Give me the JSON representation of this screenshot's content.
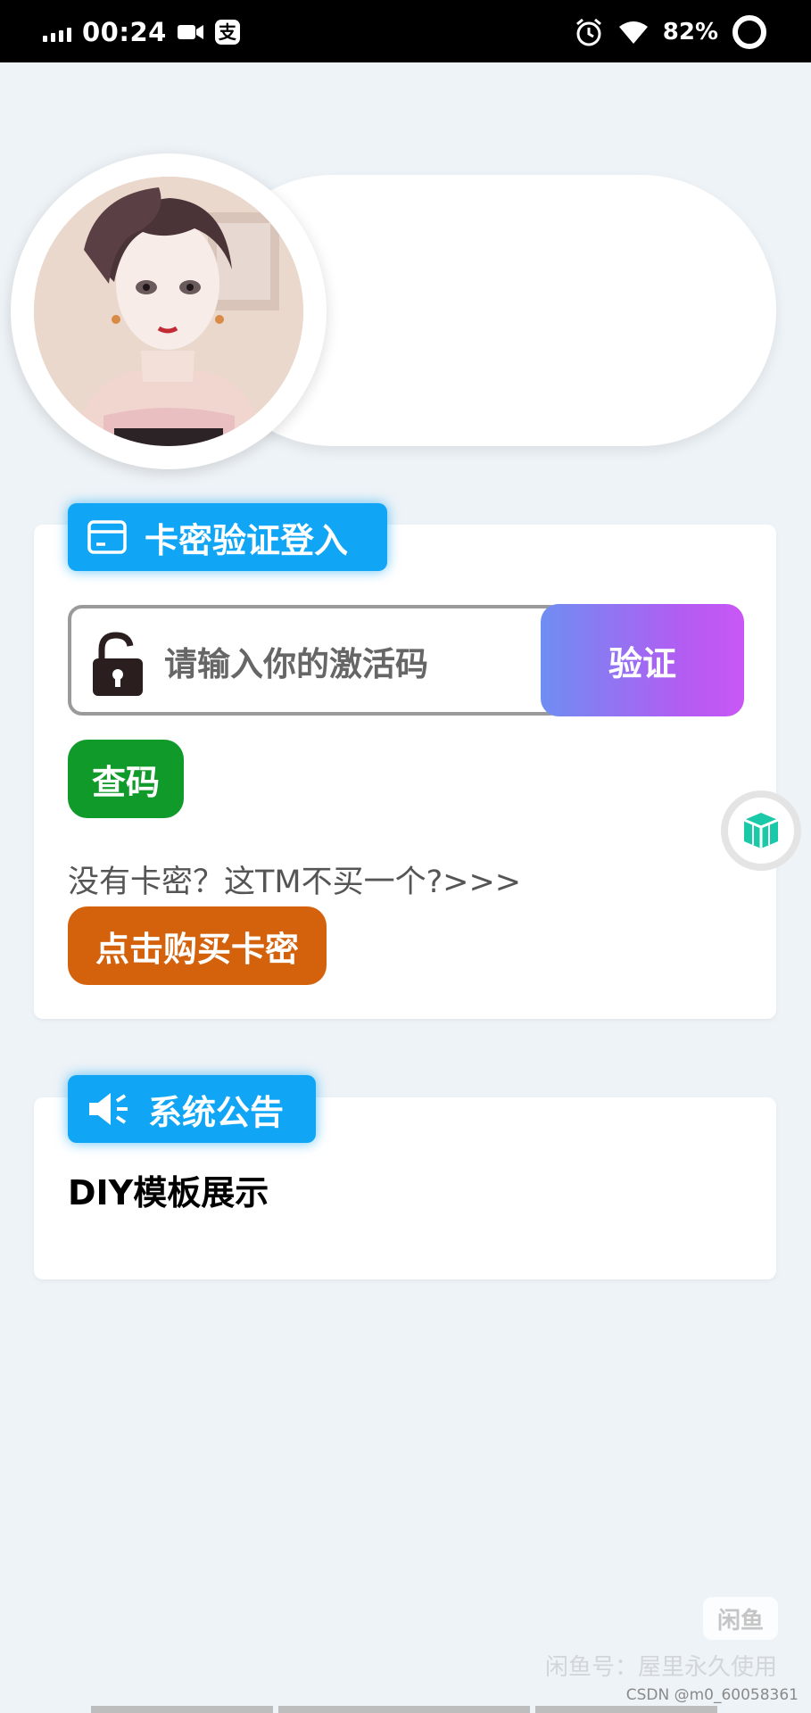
{
  "status_bar": {
    "time": "00:24",
    "pay_icon_glyph": "支",
    "battery_percent": "82%",
    "signal_icon": "signal-bars-icon",
    "icons": [
      "video-camera-icon",
      "alipay-icon",
      "alarm-clock-icon",
      "wifi-icon",
      "battery-ring-icon"
    ]
  },
  "profile": {
    "avatar_icon": "anime-portrait-avatar"
  },
  "login_card": {
    "tag_label": "卡密验证登入",
    "tag_icon": "card-icon",
    "input_placeholder": "请输入你的激活码",
    "input_icon": "lock-icon",
    "verify_label": "验证",
    "query_label": "查码",
    "no_card_text": "没有卡密？这TM不买一个?>>>",
    "buy_label": "点击购买卡密"
  },
  "floating_button": {
    "icon": "cube-icon"
  },
  "notice_card": {
    "tag_label": "系统公告",
    "tag_icon": "speaker-icon",
    "content": "DIY模板展示"
  },
  "watermark": {
    "logo_text": "闲鱼",
    "text": "闲鱼号：屋里永久使用",
    "csdn": "CSDN @m0_60058361"
  },
  "colors": {
    "background": "#eef3f7",
    "tag_blue": "#10a5f5",
    "verify_gradient_start": "#6e8ef2",
    "verify_gradient_end": "#c957f5",
    "query_green": "#0f9a2a",
    "buy_orange": "#d4620c",
    "cube_teal": "#19c9a8"
  }
}
